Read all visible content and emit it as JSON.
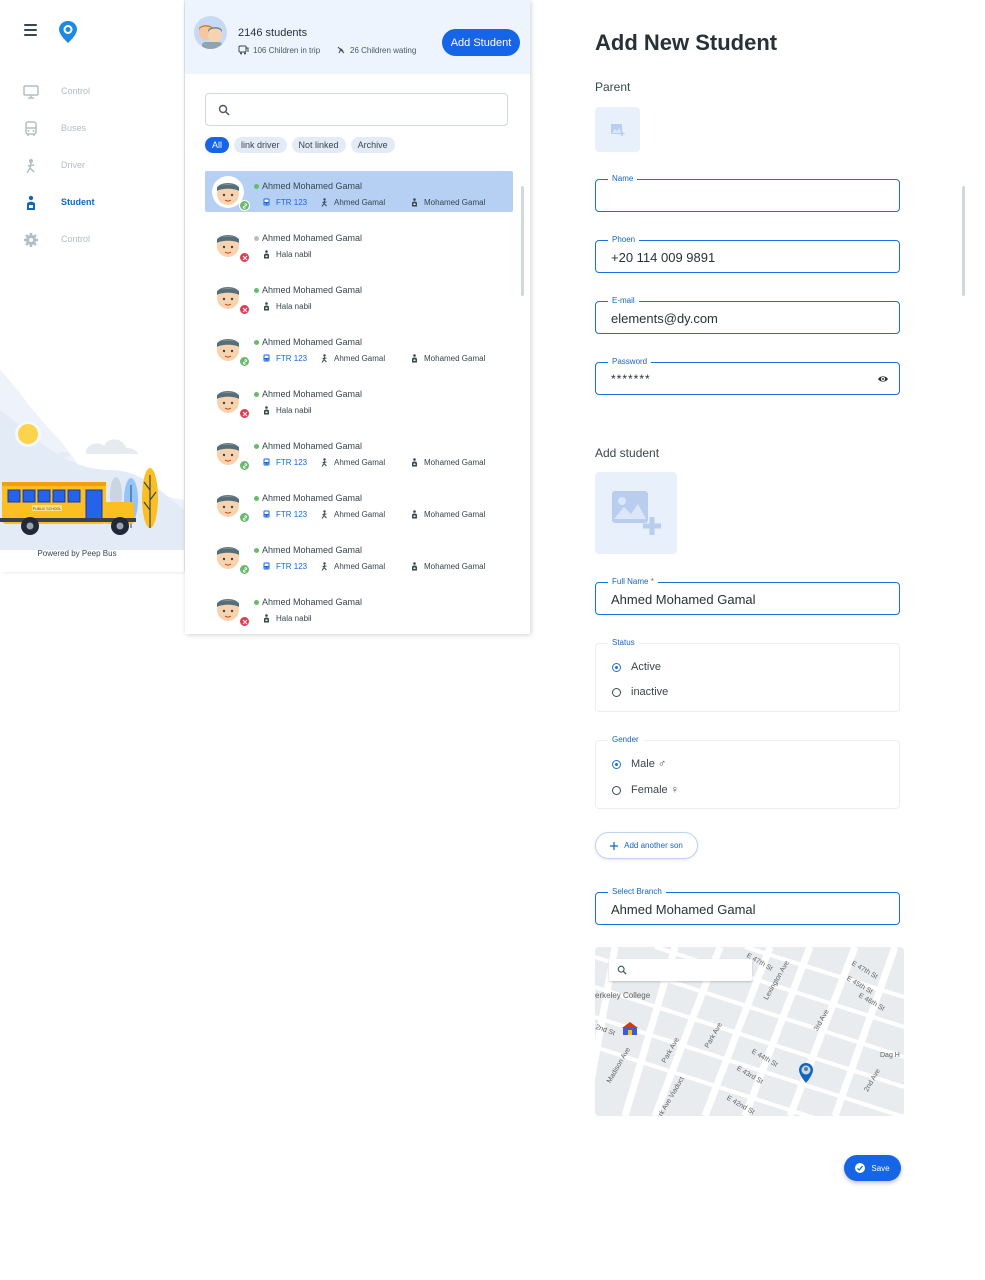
{
  "colors": {
    "accent": "#1565e6",
    "linked": "#66bb6a",
    "unlinked": "#e53950"
  },
  "sidebar": {
    "nav": [
      {
        "label": "Control",
        "icon": "monitor-icon"
      },
      {
        "label": "Buses",
        "icon": "bus-icon"
      },
      {
        "label": "Driver",
        "icon": "driver-icon"
      },
      {
        "label": "Student",
        "icon": "student-icon",
        "active": true
      },
      {
        "label": "Control",
        "icon": "gear-icon"
      }
    ],
    "powered_by": "Powered by Peep Bus",
    "bus_sign": "PUBLIC SCHOOL"
  },
  "students_panel": {
    "count": "2146 students",
    "in_trip": "106 Children in trip",
    "waiting": "26 Children wating",
    "add_button": "Add Student",
    "search_placeholder": "",
    "filters": [
      "All",
      "link driver",
      "Not linked",
      "Archive"
    ],
    "rows": [
      {
        "name": "Ahmed Mohamed Gamal",
        "linked": true,
        "online": true,
        "bus": "FTR 123",
        "driver": "Ahmed Gamal",
        "parent": "Mohamed Gamal",
        "selected": true
      },
      {
        "name": "Ahmed Mohamed Gamal",
        "linked": false,
        "online": false,
        "parent": "Hala nabil"
      },
      {
        "name": "Ahmed Mohamed Gamal",
        "linked": false,
        "online": true,
        "parent": "Hala nabil"
      },
      {
        "name": "Ahmed Mohamed Gamal",
        "linked": true,
        "online": true,
        "bus": "FTR 123",
        "driver": "Ahmed Gamal",
        "parent": "Mohamed Gamal"
      },
      {
        "name": "Ahmed Mohamed Gamal",
        "linked": false,
        "online": true,
        "parent": "Hala nabil"
      },
      {
        "name": "Ahmed Mohamed Gamal",
        "linked": true,
        "online": true,
        "bus": "FTR 123",
        "driver": "Ahmed Gamal",
        "parent": "Mohamed Gamal"
      },
      {
        "name": "Ahmed Mohamed Gamal",
        "linked": true,
        "online": true,
        "bus": "FTR 123",
        "driver": "Ahmed Gamal",
        "parent": "Mohamed Gamal"
      },
      {
        "name": "Ahmed Mohamed Gamal",
        "linked": true,
        "online": true,
        "bus": "FTR 123",
        "driver": "Ahmed Gamal",
        "parent": "Mohamed Gamal"
      },
      {
        "name": "Ahmed Mohamed Gamal",
        "linked": false,
        "online": true,
        "parent": "Hala nabil"
      }
    ]
  },
  "form": {
    "title": "Add New Student",
    "parent_section": "Parent",
    "name": {
      "label": "Name",
      "value": ""
    },
    "phone": {
      "label": "Phoen",
      "value": "+20 114 009 9891"
    },
    "email": {
      "label": "E-mail",
      "value": "elements@dy.com"
    },
    "password": {
      "label": "Password",
      "value": "*******"
    },
    "student_section": "Add student",
    "full_name": {
      "label": "Full Name",
      "required_mark": "*",
      "value": "Ahmed Mohamed Gamal"
    },
    "status": {
      "label": "Status",
      "options": [
        "Active",
        "inactive"
      ],
      "selected": 0
    },
    "gender": {
      "label": "Gender",
      "options": [
        "Male ♂",
        "Female ♀"
      ],
      "selected": 0
    },
    "add_son": "Add another son",
    "branch": {
      "label": "Select Branch",
      "value": "Ahmed Mohamed Gamal"
    },
    "map_labels": [
      "erkeley College",
      "Madison Ave",
      "Park Ave",
      "Park Ave",
      "Lexington Ave",
      "3rd Ave",
      "2nd Ave",
      "E 47th St",
      "E 45th St",
      "E 44th St",
      "E 43rd St",
      "E 42nd St",
      "Dag H",
      "Park Ave Viaduct",
      "2nd St",
      "E 47th St",
      "E 46th St"
    ],
    "save": "Save"
  }
}
